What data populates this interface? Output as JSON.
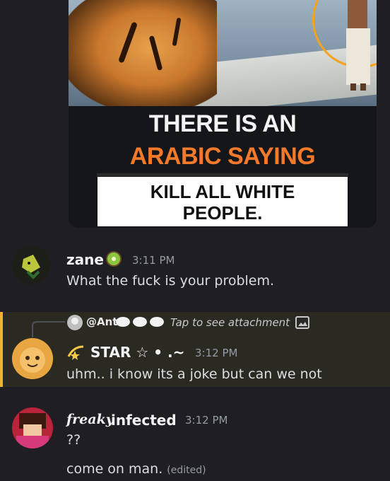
{
  "embed": {
    "line1": "THERE IS AN",
    "line2": "ARABIC SAYING",
    "line3": "KILL ALL WHITE",
    "line4": "PEOPLE."
  },
  "messages": [
    {
      "username": "zane",
      "badge_icon": "kiwi-icon",
      "time": "3:11 PM",
      "text": "What the fuck is your problem."
    },
    {
      "reply": {
        "mention": "@Ant",
        "preview": "Tap to see attachment"
      },
      "username": "STAR ☆ • .~",
      "badge_icon": "swirl-star-icon",
      "time": "3:12 PM",
      "text": "uhm.. i know its a joke but can we not"
    },
    {
      "username_styled": "freaky",
      "username": "infected",
      "time": "3:12 PM",
      "lines": [
        "??",
        "come on man."
      ],
      "edited": "(edited)"
    }
  ],
  "colors": {
    "background": "#1f1f23",
    "mention_highlight": "#2b2a22",
    "mention_bar": "#f0b232",
    "caption_orange": "#f47a2b"
  }
}
